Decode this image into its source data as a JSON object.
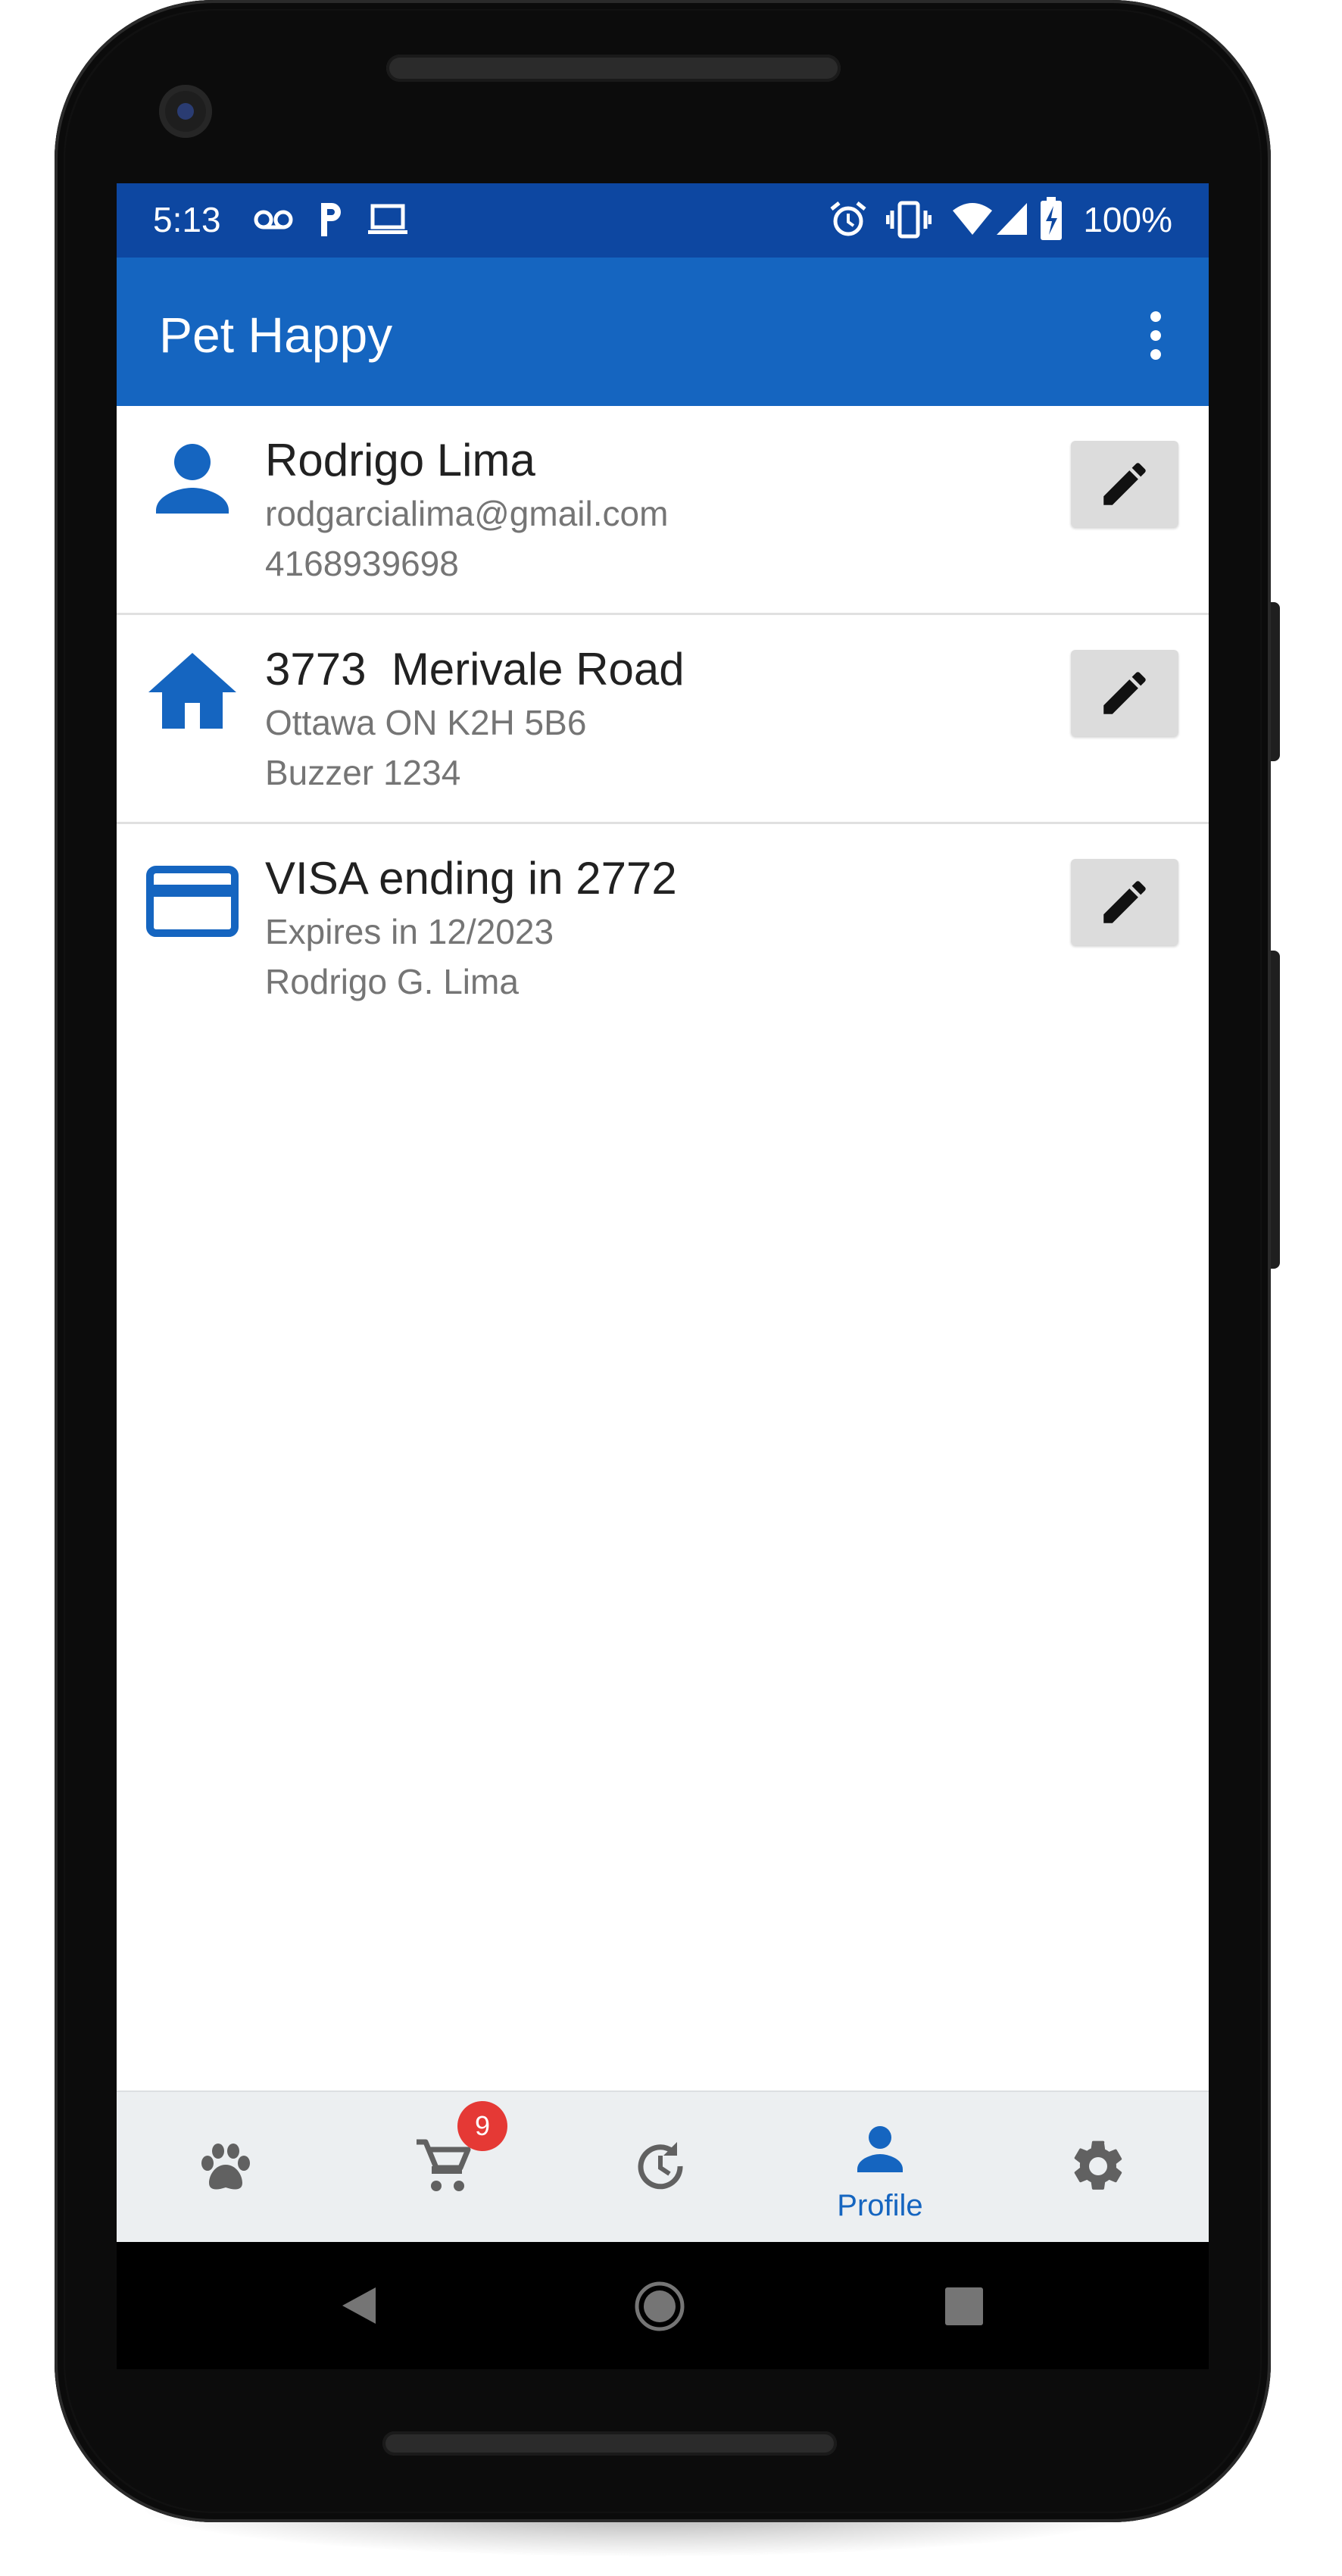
{
  "status_bar": {
    "time": "5:13",
    "battery_percent": "100%",
    "left_icons": [
      "voicemail-icon",
      "parking-app-icon",
      "laptop-icon"
    ],
    "right_icons": [
      "alarm-icon",
      "vibrate-icon",
      "wifi-icon",
      "cell-signal-icon",
      "battery-charging-icon"
    ]
  },
  "app_bar": {
    "title": "Pet Happy",
    "menu_icon": "more-vert-icon"
  },
  "profile": {
    "rows": [
      {
        "icon": "person-icon",
        "title": "Rodrigo Lima",
        "line1": "rodgarcialima@gmail.com",
        "line2": "4168939698",
        "action_icon": "pencil-icon"
      },
      {
        "icon": "home-icon",
        "title": "3773  Merivale Road",
        "line1": "Ottawa ON K2H 5B6",
        "line2": "Buzzer 1234",
        "action_icon": "pencil-icon"
      },
      {
        "icon": "credit-card-icon",
        "title": "VISA ending in 2772",
        "line1": "Expires in 12/2023",
        "line2": "Rodrigo G. Lima",
        "action_icon": "pencil-icon"
      }
    ]
  },
  "bottom_nav": {
    "items": [
      {
        "icon": "paw-icon",
        "label": "",
        "active": false
      },
      {
        "icon": "cart-icon",
        "label": "",
        "active": false,
        "badge": "9"
      },
      {
        "icon": "history-icon",
        "label": "",
        "active": false
      },
      {
        "icon": "person-icon",
        "label": "Profile",
        "active": true
      },
      {
        "icon": "gear-icon",
        "label": "",
        "active": false
      }
    ]
  },
  "system_nav": {
    "buttons": [
      "back-icon",
      "home-circle-icon",
      "recents-icon"
    ]
  },
  "colors": {
    "status_bar": "#0d47a1",
    "app_bar": "#1565c0",
    "accent": "#1565c0",
    "badge": "#e53935",
    "nav_background": "#eceff1",
    "secondary_text": "#757575",
    "edit_button": "#dcdcdc"
  }
}
